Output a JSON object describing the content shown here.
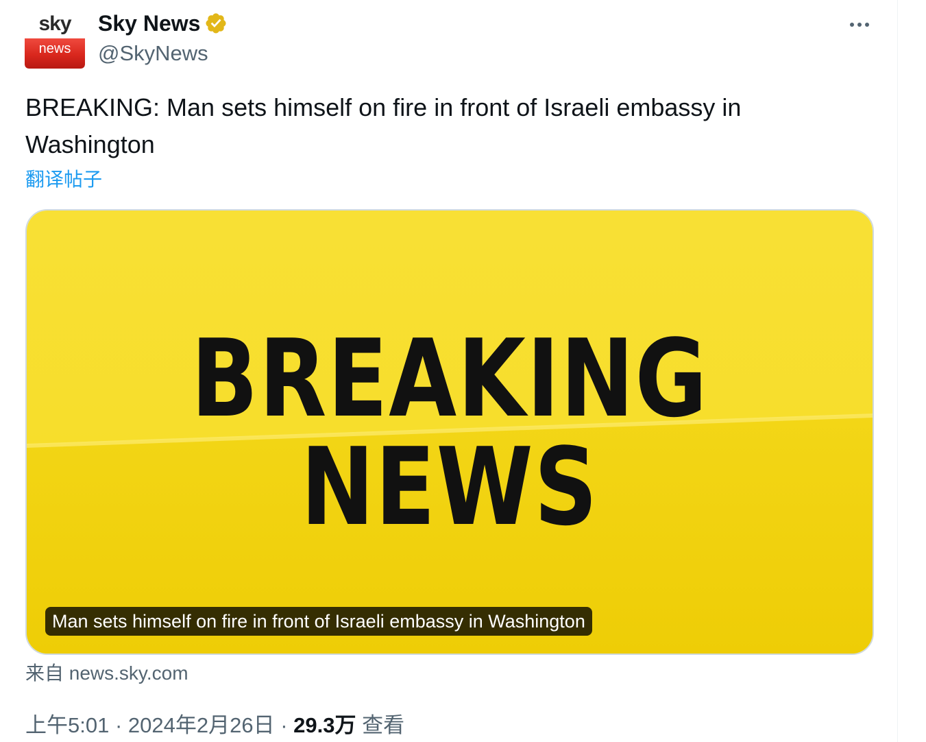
{
  "colors": {
    "accent_link": "#1d9bf0",
    "verified_badge": "#e2b719",
    "media_yellow": "#f5d90f",
    "secondary_text": "#536471",
    "avatar_red": "#d9271d"
  },
  "post": {
    "author": {
      "display_name": "Sky News",
      "handle": "@SkyNews",
      "verified_icon": "gold-verified-badge-icon",
      "avatar": {
        "top_word": "sky",
        "bottom_word": "news"
      }
    },
    "more_icon": "more-horizontal-icon",
    "text": "BREAKING: Man sets himself on fire in front of Israeli embassy in Washington",
    "translate_label": "翻译帖子",
    "media": {
      "headline_line1": "BREAKING",
      "headline_line2": "NEWS",
      "caption": "Man sets himself on fire in front of Israeli embassy in Washington"
    },
    "source": "来自 news.sky.com",
    "meta": {
      "time": "上午5:01",
      "separator1": " · ",
      "date": "2024年2月26日",
      "separator2": " · ",
      "views_count": "29.3万",
      "views_label": " 查看"
    }
  }
}
